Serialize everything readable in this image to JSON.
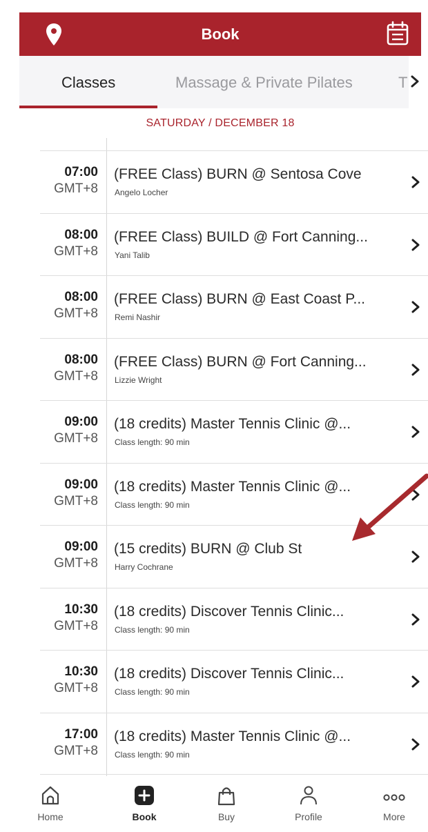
{
  "header": {
    "title": "Book",
    "left_icon": "location-pin-icon",
    "right_icon": "calendar-icon",
    "color": "#a9232c"
  },
  "tabs": [
    {
      "label": "Classes",
      "active": true
    },
    {
      "label": "Massage & Private Pilates",
      "active": false
    },
    {
      "label": "T",
      "active": false
    }
  ],
  "date_label": "SATURDAY / DECEMBER 18",
  "classes": [
    {
      "time": "07:00",
      "tz": "GMT+8",
      "name": "(FREE Class) BURN @ Sentosa Cove",
      "subtitle": "Angelo Locher"
    },
    {
      "time": "08:00",
      "tz": "GMT+8",
      "name": "(FREE Class) BUILD @ Fort Canning...",
      "subtitle": "Yani Talib"
    },
    {
      "time": "08:00",
      "tz": "GMT+8",
      "name": "(FREE Class) BURN @ East Coast P...",
      "subtitle": "Remi Nashir"
    },
    {
      "time": "08:00",
      "tz": "GMT+8",
      "name": "(FREE Class) BURN @ Fort Canning...",
      "subtitle": "Lizzie Wright"
    },
    {
      "time": "09:00",
      "tz": "GMT+8",
      "name": "(18 credits) Master Tennis Clinic @...",
      "subtitle": "Class length: 90 min"
    },
    {
      "time": "09:00",
      "tz": "GMT+8",
      "name": "(18 credits) Master Tennis Clinic @...",
      "subtitle": "Class length: 90 min"
    },
    {
      "time": "09:00",
      "tz": "GMT+8",
      "name": "(15 credits) BURN @ Club St",
      "subtitle": "Harry Cochrane"
    },
    {
      "time": "10:30",
      "tz": "GMT+8",
      "name": "(18 credits) Discover Tennis Clinic...",
      "subtitle": "Class length: 90 min"
    },
    {
      "time": "10:30",
      "tz": "GMT+8",
      "name": "(18 credits) Discover Tennis Clinic...",
      "subtitle": "Class length: 90 min"
    },
    {
      "time": "17:00",
      "tz": "GMT+8",
      "name": "(18 credits) Master Tennis Clinic @...",
      "subtitle": "Class length: 90 min"
    }
  ],
  "nav": [
    {
      "label": "Home",
      "icon": "home-icon"
    },
    {
      "label": "Book",
      "icon": "book-plus-icon",
      "active": true
    },
    {
      "label": "Buy",
      "icon": "shopping-bag-icon"
    },
    {
      "label": "Profile",
      "icon": "profile-icon"
    },
    {
      "label": "More",
      "icon": "more-dots-icon"
    }
  ],
  "accent_color": "#a9232c"
}
